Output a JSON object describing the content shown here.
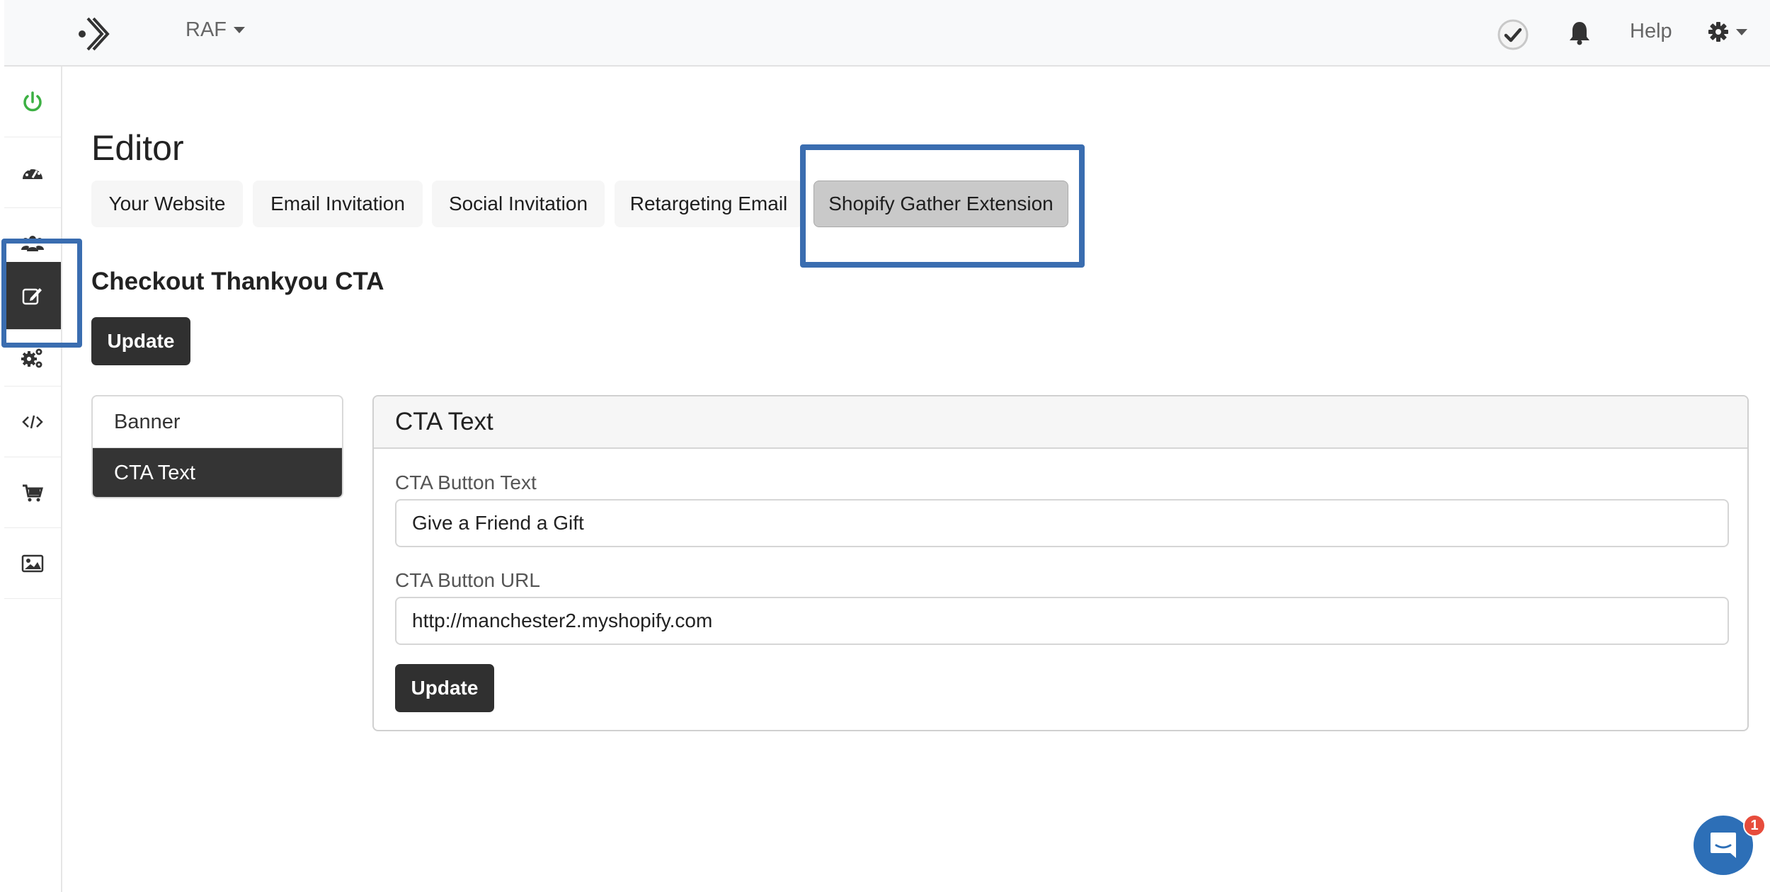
{
  "topbar": {
    "app_name": "RAF",
    "help_label": "Help"
  },
  "sidebar": {
    "items": [
      {
        "icon": "power-icon",
        "active": false
      },
      {
        "icon": "dashboard-icon",
        "active": false
      },
      {
        "icon": "users-icon",
        "active": false
      },
      {
        "icon": "edit-icon",
        "active": true
      },
      {
        "icon": "cogs-icon",
        "active": false
      },
      {
        "icon": "code-icon",
        "active": false
      },
      {
        "icon": "shop-cart-icon",
        "active": false
      },
      {
        "icon": "image-icon",
        "active": false
      }
    ]
  },
  "page": {
    "title": "Editor",
    "tabs": [
      {
        "label": "Your Website"
      },
      {
        "label": "Email Invitation"
      },
      {
        "label": "Social Invitation"
      },
      {
        "label": "Retargeting Email"
      },
      {
        "label": "Shopify Gather Extension",
        "active": true
      }
    ],
    "section_title": "Checkout Thankyou CTA",
    "update_label": "Update"
  },
  "menu": {
    "items": [
      {
        "label": "Banner",
        "active": false
      },
      {
        "label": "CTA Text",
        "active": true
      }
    ]
  },
  "card": {
    "title": "CTA Text",
    "fields": [
      {
        "label": "CTA Button Text",
        "value": "Give a Friend a Gift"
      },
      {
        "label": "CTA Button URL",
        "value": "http://manchester2.myshopify.com"
      }
    ],
    "update_label": "Update"
  },
  "chat": {
    "badge_count": "1"
  },
  "colors": {
    "highlight": "#3a6db0",
    "active_dark": "#343434",
    "power_green": "#3cb043",
    "chat_blue": "#2d6fb7",
    "badge_red": "#e74c3c"
  }
}
